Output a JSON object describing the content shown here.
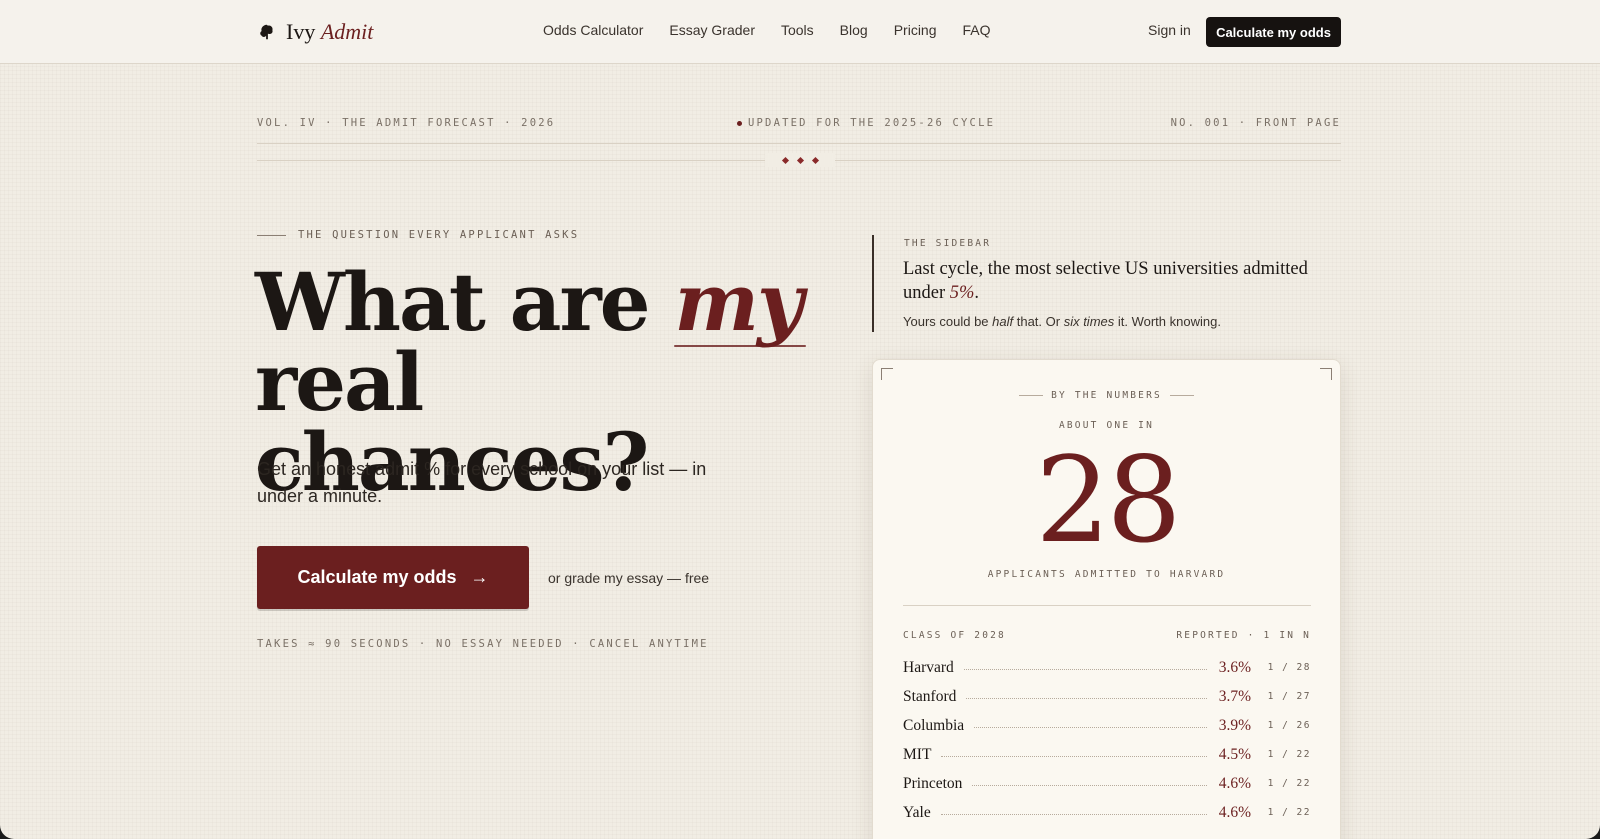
{
  "nav": {
    "logo_word": "Ivy",
    "logo_accent": "Admit",
    "logo_icon": "leaf-icon",
    "links": [
      "Odds Calculator",
      "Essay Grader",
      "Tools",
      "Blog",
      "Pricing",
      "FAQ"
    ],
    "sign_in": "Sign in",
    "cta": "Calculate my odds"
  },
  "masthead": {
    "left": "VOL. IV · THE ADMIT FORECAST · 2026",
    "center": "UPDATED FOR THE 2025-26 CYCLE",
    "right": "NO. 001 · FRONT PAGE"
  },
  "hero": {
    "kicker": "THE QUESTION EVERY APPLICANT ASKS",
    "headline_part1": "What are ",
    "headline_accent": "my",
    "headline_part2": "real chances?",
    "subhead": "Get an honest admit % for every school on your list — in under a minute.",
    "cta": "Calculate my odds",
    "cta_arrow": "→",
    "secondary_link": "or grade my essay — free",
    "fine_print": "TAKES ≈ 90 SECONDS · NO ESSAY NEEDED · CANCEL ANYTIME"
  },
  "sidebar": {
    "label": "THE SIDEBAR",
    "title_part1": "Last cycle, the most selective US universities admitted under ",
    "title_accent": "5%",
    "title_part2": ".",
    "sub_part1": "Yours could be ",
    "sub_em1": "half",
    "sub_part2": " that. Or ",
    "sub_em2": "six times",
    "sub_part3": " it. Worth knowing."
  },
  "card": {
    "header": "BY THE NUMBERS",
    "about": "ABOUT ONE IN",
    "big_number": "28",
    "caption": "APPLICANTS ADMITTED TO HARVARD",
    "table_left": "CLASS OF 2028",
    "table_right": "REPORTED · 1 IN N",
    "rows": [
      {
        "name": "Harvard",
        "pct": "3.6%",
        "ratio": "1 / 28"
      },
      {
        "name": "Stanford",
        "pct": "3.7%",
        "ratio": "1 / 27"
      },
      {
        "name": "Columbia",
        "pct": "3.9%",
        "ratio": "1 / 26"
      },
      {
        "name": "MIT",
        "pct": "4.5%",
        "ratio": "1 / 22"
      },
      {
        "name": "Princeton",
        "pct": "4.6%",
        "ratio": "1 / 22"
      },
      {
        "name": "Yale",
        "pct": "4.6%",
        "ratio": "1 / 22"
      }
    ]
  },
  "colors": {
    "accent": "#6b1f1f",
    "background": "#f1ede4",
    "ink": "#1c1714"
  }
}
